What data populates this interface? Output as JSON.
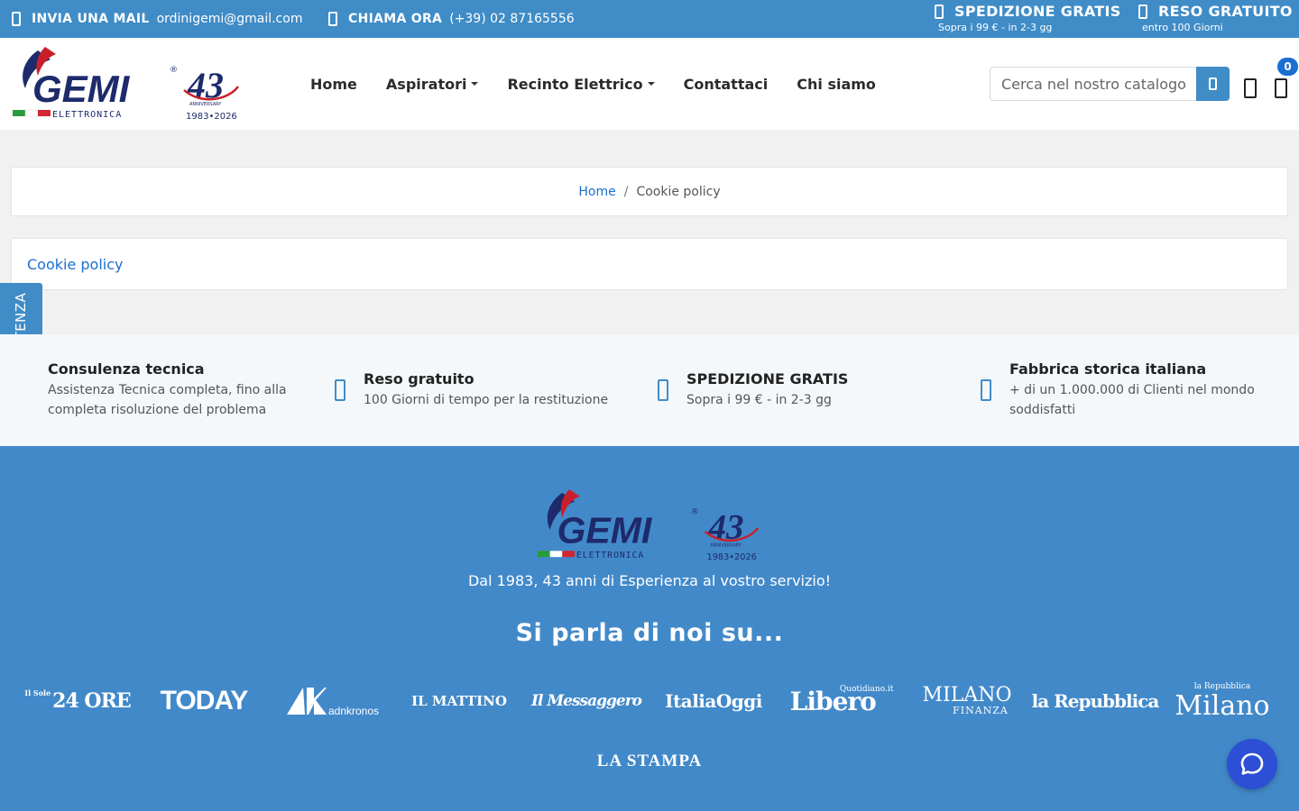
{
  "topbar": {
    "email_label": "INVIA UNA MAIL",
    "email_value": "ordinigemi@gmail.com",
    "phone_label": "CHIAMA ORA",
    "phone_value": "(+39) 02 87165556",
    "shipping_title": "SPEDIZIONE GRATIS",
    "shipping_sub": "Sopra i 99 € - in 2-3 gg",
    "return_title": "RESO GRATUITO",
    "return_sub": "entro 100 Giorni"
  },
  "logo": {
    "brand": "GEMI",
    "subbrand": "ELETTRONICA",
    "anniversary": "43",
    "anniversary_word": "ANNIVERSARY",
    "years": "1983•2026",
    "registered": "®"
  },
  "nav": {
    "items": [
      {
        "label": "Home"
      },
      {
        "label": "Aspiratori"
      },
      {
        "label": "Recinto Elettrico"
      },
      {
        "label": "Contattaci"
      },
      {
        "label": "Chi siamo"
      }
    ]
  },
  "search": {
    "placeholder": "Cerca nel nostro catalogo"
  },
  "cart": {
    "count": "0"
  },
  "breadcrumb": {
    "home": "Home",
    "separator": "/",
    "current": "Cookie policy"
  },
  "page": {
    "title": "Cookie policy"
  },
  "assist_tab": {
    "label": "ASSISTENZA"
  },
  "features": [
    {
      "title": "Consulenza tecnica",
      "desc": "Assistenza Tecnica completa, fino alla completa risoluzione del problema"
    },
    {
      "title": "Reso gratuito",
      "desc": "100 Giorni di tempo per la restituzione"
    },
    {
      "title": "SPEDIZIONE GRATIS",
      "desc": "Sopra i 99 € - in 2-3 gg"
    },
    {
      "title": "Fabbrica storica italiana",
      "desc": "+ di un 1.000.000 di Clienti nel mondo soddisfatti"
    }
  ],
  "footer": {
    "tagline": "Dal 1983, 43 anni di Esperienza al vostro servizio!",
    "heading": "Si parla di noi su...",
    "press": {
      "sole_prefix": "Il Sole",
      "sole": "24 ORE",
      "today": "TODAY",
      "adnkronos": "adnkronos",
      "mattino": "IL MATTINO",
      "messaggero": "Il Messaggero",
      "italiaoggi": "ItaliaOggi",
      "libero": "Libero",
      "libero_sub": "Quotidiano.it",
      "milanofinanza": "MILANO",
      "milanofinanza_sub": "FINANZA",
      "repubblica": "la Repubblica",
      "repmilano_top": "la Repubblica",
      "repmilano": "Milano",
      "stampa": "LA STAMPA"
    }
  },
  "colors": {
    "primary": "#3f8cc7",
    "footer_bg": "#4289c9",
    "link": "#1a6fd0",
    "chat": "#2c4fd6"
  }
}
